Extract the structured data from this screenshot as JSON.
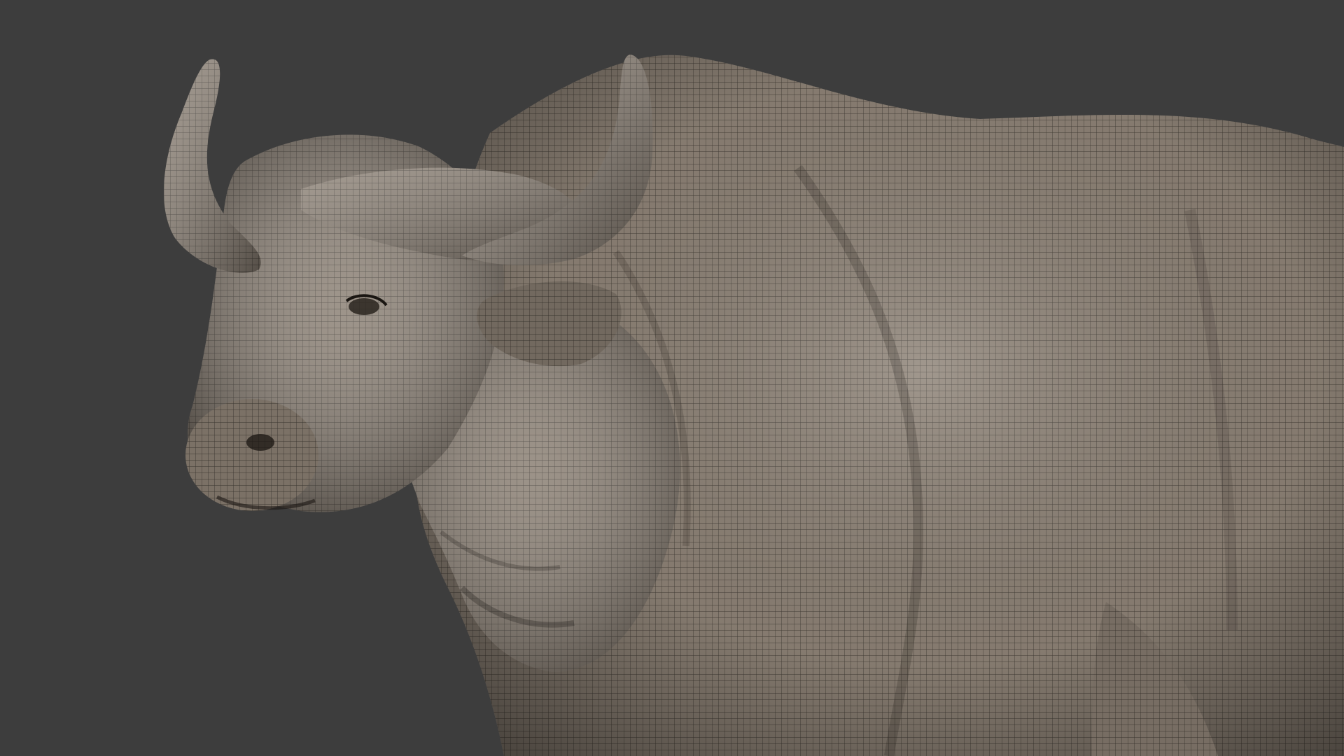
{
  "viewport": {
    "background_color": "#3d3d3d",
    "mesh_surface_color": "#8a7e72",
    "mesh_line_color": "#2a2520",
    "subject_icon": "buffalo-wireframe-model"
  }
}
